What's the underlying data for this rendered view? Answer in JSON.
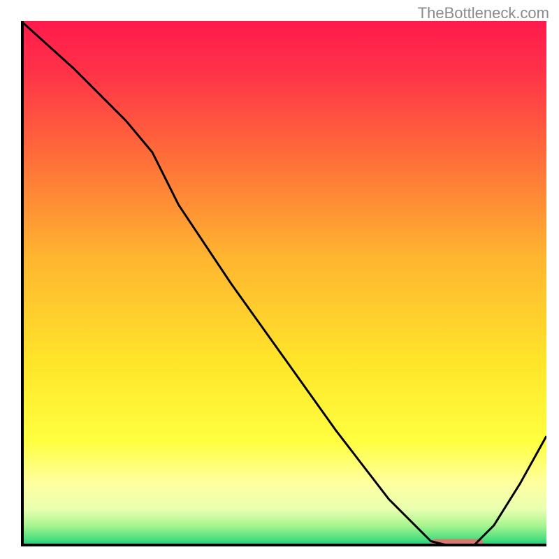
{
  "watermark": "TheBottleneck.com",
  "chart_data": {
    "type": "line",
    "title": "",
    "xlabel": "",
    "ylabel": "",
    "xlim": [
      0,
      100
    ],
    "ylim": [
      0,
      100
    ],
    "background_gradient": {
      "stops": [
        {
          "pos": 0.0,
          "color": "#ff1a4d"
        },
        {
          "pos": 0.1,
          "color": "#ff3348"
        },
        {
          "pos": 0.25,
          "color": "#ff6a3a"
        },
        {
          "pos": 0.45,
          "color": "#ffb530"
        },
        {
          "pos": 0.65,
          "color": "#ffe52a"
        },
        {
          "pos": 0.8,
          "color": "#ffff40"
        },
        {
          "pos": 0.88,
          "color": "#ffffa0"
        },
        {
          "pos": 0.93,
          "color": "#e8ffb0"
        },
        {
          "pos": 0.96,
          "color": "#a8f590"
        },
        {
          "pos": 0.985,
          "color": "#50e080"
        },
        {
          "pos": 1.0,
          "color": "#18c878"
        }
      ]
    },
    "series": [
      {
        "name": "curve",
        "color": "#000000",
        "x": [
          0,
          10,
          20,
          25,
          30,
          40,
          50,
          60,
          70,
          78,
          82,
          86,
          90,
          95,
          100
        ],
        "y": [
          100,
          91,
          81,
          75,
          65,
          50,
          36,
          22,
          9,
          1,
          0,
          0,
          4,
          12,
          21
        ]
      }
    ],
    "marker": {
      "name": "highlight-segment",
      "color": "#d9786f",
      "x_start": 78,
      "x_end": 88,
      "y": 0.6,
      "thickness": 1.6
    },
    "axes_color": "#000000",
    "axes_width": 4
  }
}
